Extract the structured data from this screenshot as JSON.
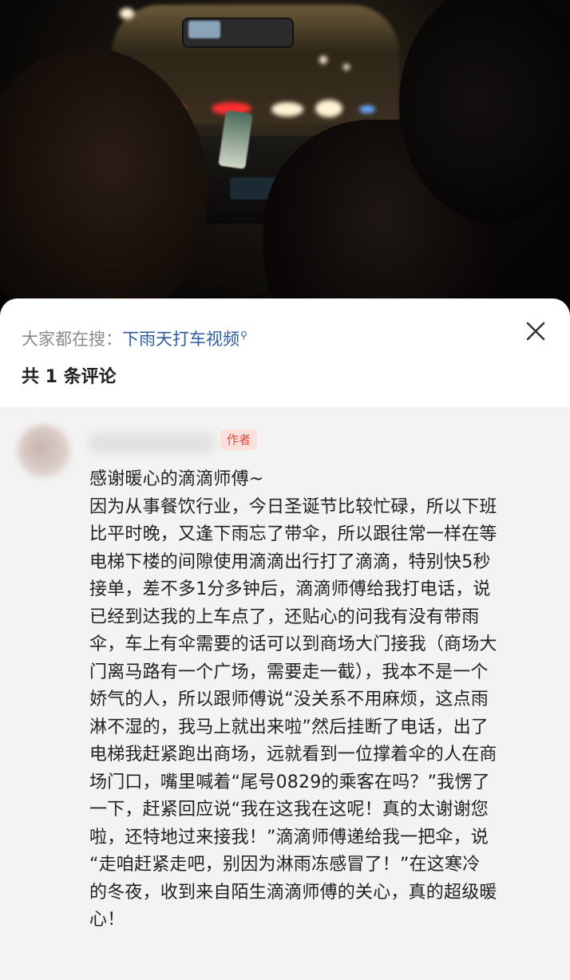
{
  "video": {
    "description_icon": "dashcam-night-video"
  },
  "sheet": {
    "search_prefix": "大家都在搜：",
    "search_query": "下雨天打车视频",
    "search_icon": "search-icon",
    "close_icon": "close-icon",
    "comment_count_label": "共 1 条评论"
  },
  "comment": {
    "author_badge": "作者",
    "lines": [
      "感谢暖心的滴滴师傅~",
      "因为从事餐饮行业，今日圣诞节比较忙碌，所以下班",
      "比平时晚，又逢下雨忘了带伞，所以跟往常一样在等",
      "电梯下楼的间隙使用滴滴出行打了滴滴，特别快5秒",
      "接单，差不多1分多钟后，滴滴师傅给我打电话，说",
      "已经到达我的上车点了，还贴心的问我有没有带雨",
      "伞，车上有伞需要的话可以到商场大门接我（商场大",
      "门离马路有一个广场，需要走一截），我本不是一个",
      "娇气的人，所以跟师傅说“没关系不用麻烦，这点雨",
      "淋不湿的，我马上就出来啦”然后挂断了电话，出了",
      "电梯我赶紧跑出商场，远就看到一位撑着伞的人在商",
      "场门口，嘴里喊着“尾号0829的乘客在吗？”我愣了",
      "一下，赶紧回应说“我在这我在这呢！真的太谢谢您",
      "啦，还特地过来接我！”滴滴师傅递给我一把伞，说",
      "“走咱赶紧走吧，别因为淋雨冻感冒了！”在这寒冷",
      "的冬夜，收到来自陌生滴滴师傅的关心，真的超级暖",
      "心！"
    ]
  },
  "colors": {
    "accent_link": "#2f5d9e",
    "author_badge_text": "#e4473b",
    "author_badge_bg": "#fbe1dc",
    "comment_bg": "#f3f3f3"
  }
}
